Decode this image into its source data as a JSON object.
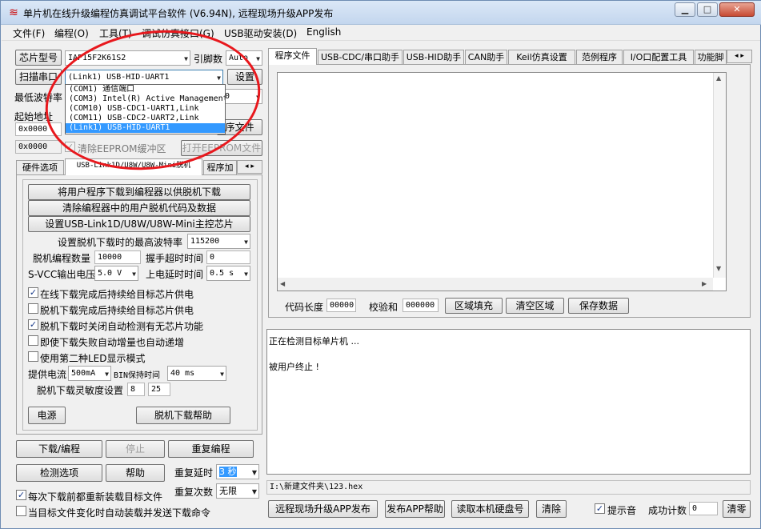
{
  "window": {
    "title": "单片机在线升级编程仿真调试平台软件 (V6.94N), 远程现场升级APP发布",
    "min": "▁",
    "max": "□",
    "close": "✕"
  },
  "menu": [
    "文件(F)",
    "编程(O)",
    "工具(T)",
    "调试仿真接口(G)",
    "USB驱动安装(D)",
    "English"
  ],
  "left": {
    "chip_type_btn": "芯片型号",
    "chip_model": "IAP15F2K61S2",
    "pin_label": "引脚数",
    "pin_value": "Auto",
    "scan_port_btn": "扫描串口",
    "port_value": "(Link1) USB-HID-UART1",
    "settings_btn": "设置",
    "min_baud_label": "最低波特率",
    "min_baud_value": "0",
    "start_addr_label": "起始地址",
    "addr1_value": "0x0000",
    "open_prog_btn": "序文件",
    "addr2_value": "0x0000",
    "clear_eeprom_label": "清除EEPROM缓冲区",
    "open_eeprom_btn": "打开EEPROM文件",
    "port_options": [
      "(COM1) 通信端口",
      "(COM3) Intel(R) Active Management",
      "(COM10) USB-CDC1-UART1,Link",
      "(COM11) USB-CDC2-UART2,Link",
      "(Link1) USB-HID-UART1"
    ],
    "tabs": [
      "硬件选项",
      "USB-Link1D/U8W/U8W-Mini脱机",
      "程序加"
    ],
    "offline": {
      "btn_download_offline": "将用户程序下载到编程器以供脱机下载",
      "btn_clear_offline": "清除编程器中的用户脱机代码及数据",
      "btn_set_main_chip": "设置USB-Link1D/U8W/U8W-Mini主控芯片",
      "max_baud_label": "设置脱机下载时的最高波特率",
      "max_baud_value": "115200",
      "count_label": "脱机编程数量",
      "count_value": "10000",
      "handshake_label": "握手超时时间",
      "handshake_value": "0",
      "svcc_label": "S-VCC输出电压",
      "svcc_value": "5.0 V",
      "power_delay_label": "上电延时时间",
      "power_delay_value": "0.5 s",
      "opt1": "在线下载完成后持续给目标芯片供电",
      "opt2": "脱机下载完成后持续给目标芯片供电",
      "opt3": "脱机下载时关闭自动检测有无芯片功能",
      "opt4": "即使下载失败自动增量也自动递增",
      "opt5": "使用第二种LED显示模式",
      "current_label": "提供电流",
      "current_value": "500mA",
      "bin_hold_label": "BIN保持时间",
      "bin_hold_value": "40 ms",
      "sensitivity_label": "脱机下载灵敏度设置",
      "sens1": "8",
      "sens2": "25",
      "power_btn": "电源",
      "help_btn": "脱机下载帮助"
    },
    "btn_download": "下载/编程",
    "btn_stop": "停止",
    "btn_reprogram": "重复编程",
    "btn_check": "检测选项",
    "btn_help": "帮助",
    "repeat_delay_label": "重复延时",
    "repeat_delay_value": "3 秒",
    "repeat_count_label": "重复次数",
    "repeat_count_value": "无限",
    "reload_label": "每次下载前都重新装载目标文件",
    "auto_load_label": "当目标文件变化时自动装载并发送下载命令"
  },
  "right": {
    "tabs": [
      "程序文件",
      "USB-CDC/串口助手",
      "USB-HID助手",
      "CAN助手",
      "Keil仿真设置",
      "范例程序",
      "I/O口配置工具",
      "功能脚"
    ],
    "code_len_label": "代码长度",
    "code_len_value": "00000",
    "checksum_label": "校验和",
    "checksum_value": "000000",
    "btn_fill": "区域填充",
    "btn_clear_area": "清空区域",
    "btn_save": "保存数据",
    "log_lines": [
      "正在检测目标单片机 ...",
      "",
      "被用户终止 !"
    ],
    "file_path": "I:\\新建文件夹\\123.hex",
    "btn_remote": "远程现场升级APP发布",
    "btn_publish_help": "发布APP帮助",
    "btn_read_disk": "读取本机硬盘号",
    "btn_clear": "清除",
    "beep_label": "提示音",
    "success_label": "成功计数",
    "success_value": "0",
    "btn_clear_zero": "清零"
  }
}
